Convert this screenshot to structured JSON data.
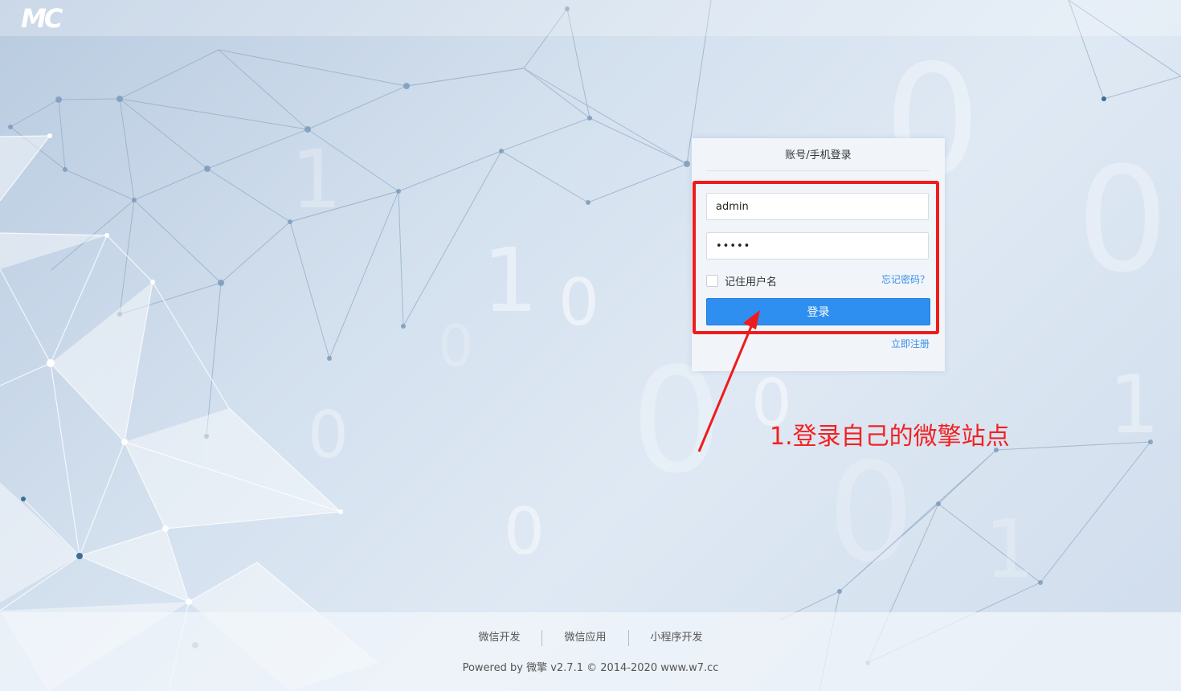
{
  "header": {
    "logo_text": "MC"
  },
  "background": {
    "digits": [
      "0",
      "1",
      "1",
      "0",
      "0",
      "0",
      "0",
      "0",
      "1",
      "0",
      "0",
      "1",
      "0"
    ]
  },
  "login": {
    "title": "账号/手机登录",
    "username_value": "admin",
    "password_value": "•••••",
    "remember_label": "记住用户名",
    "forgot_label": "忘记密码？",
    "login_button": "登录",
    "register_label": "立即注册"
  },
  "annotation": {
    "text": "1.登录自己的微擎站点",
    "color": "#f22121"
  },
  "footer": {
    "links": [
      "微信开发",
      "微信应用",
      "小程序开发"
    ],
    "copyright": "Powered by 微擎 v2.7.1 © 2014-2020 www.w7.cc"
  },
  "colors": {
    "accent": "#2f8ff0",
    "highlight_box": "#ee1c1c"
  }
}
